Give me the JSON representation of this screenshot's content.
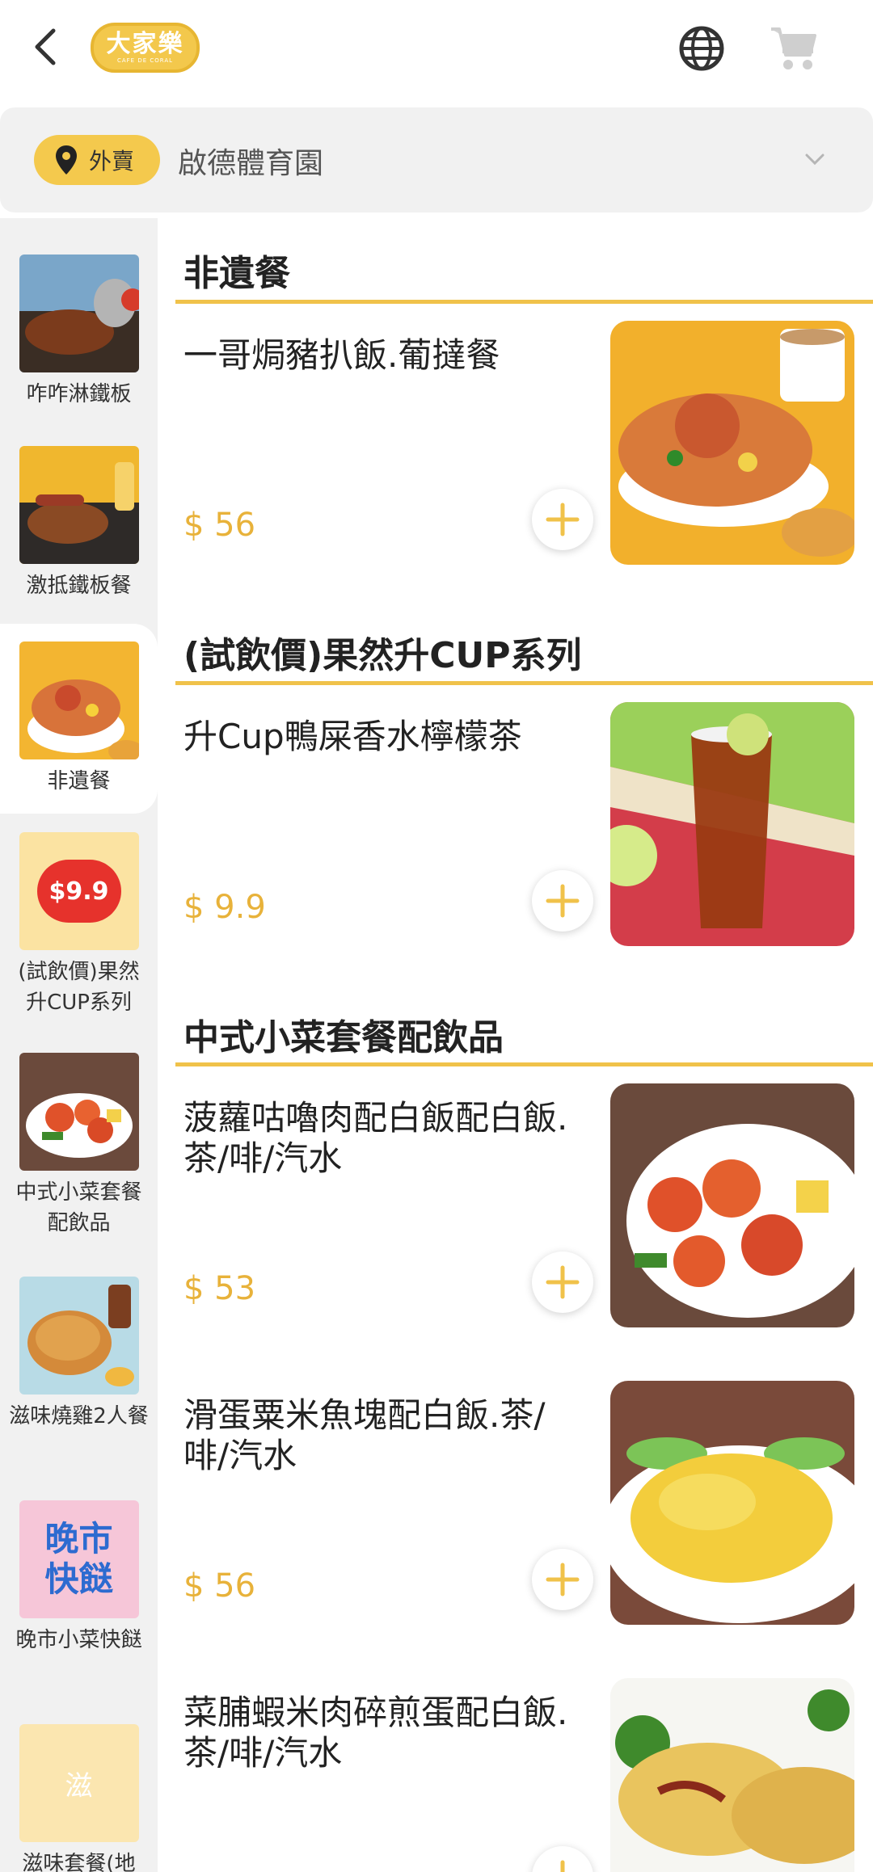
{
  "header": {
    "logo_text": "大家樂",
    "logo_sub": "CAFE DE CORAL"
  },
  "location": {
    "mode": "外賣",
    "store": "啟德體育園"
  },
  "sidebar": {
    "items": [
      {
        "label": "咋咋淋鐵板"
      },
      {
        "label": "激抵鐵板餐"
      },
      {
        "label": "非遺餐"
      },
      {
        "label": "(試飲價)果然升CUP系列",
        "badge": "$9.9"
      },
      {
        "label": "中式小菜套餐配飲品"
      },
      {
        "label": "滋味燒雞2人餐"
      },
      {
        "label": "晚市小菜快餸",
        "badge": "晚市快餸"
      },
      {
        "label": "滋味套餐(地",
        "badge": "滋"
      }
    ]
  },
  "sections": [
    {
      "title": "非遺餐",
      "items": [
        {
          "name": "一哥焗豬扒飯.葡撻餐",
          "price": "$ 56"
        }
      ]
    },
    {
      "title": "(試飲價)果然升CUP系列",
      "items": [
        {
          "name": "升Cup鴨屎香水檸檬茶",
          "price": "$ 9.9"
        }
      ]
    },
    {
      "title": "中式小菜套餐配飲品",
      "items": [
        {
          "name": "菠蘿咕嚕肉配白飯配白飯.茶/啡/汽水",
          "price": "$ 53"
        },
        {
          "name": "滑蛋粟米魚塊配白飯.茶/啡/汽水",
          "price": "$ 56"
        },
        {
          "name": "菜脯蝦米肉碎煎蛋配白飯.茶/啡/汽水",
          "price": ""
        }
      ]
    }
  ],
  "colors": {
    "accent": "#f4c94d",
    "price": "#e8b23a",
    "sidebar_bg": "#f1f1f1"
  }
}
